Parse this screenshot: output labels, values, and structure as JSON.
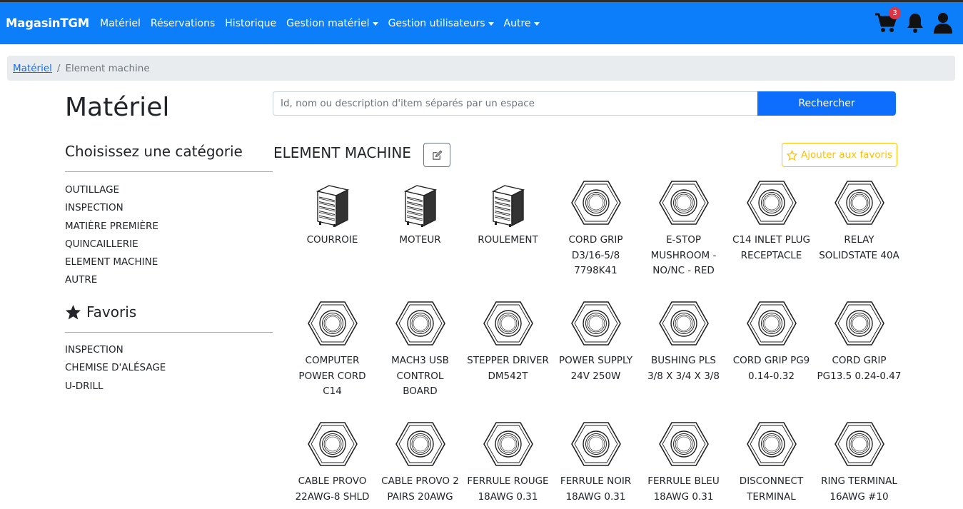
{
  "header": {
    "brand": "MagasinTGM",
    "nav": [
      {
        "label": "Matériel",
        "dropdown": false
      },
      {
        "label": "Réservations",
        "dropdown": false
      },
      {
        "label": "Historique",
        "dropdown": false
      },
      {
        "label": "Gestion matériel",
        "dropdown": true
      },
      {
        "label": "Gestion utilisateurs",
        "dropdown": true
      },
      {
        "label": "Autre",
        "dropdown": true
      }
    ],
    "cart_count": "3",
    "icons": [
      "cart-icon",
      "bell-icon",
      "user-icon"
    ],
    "bg_color": "#0d7efa"
  },
  "breadcrumb": {
    "link": "Matériel",
    "current": "Element machine"
  },
  "page": {
    "title": "Matériel"
  },
  "search": {
    "placeholder": "Id, nom ou description d'item séparés par un espace",
    "button": "Rechercher"
  },
  "sidebar": {
    "categories_title": "Choisissez une catégorie",
    "categories": [
      "OUTILLAGE",
      "INSPECTION",
      "MATIÈRE PREMIÈRE",
      "QUINCAILLERIE",
      "ELEMENT MACHINE",
      "AUTRE"
    ],
    "favorites_title": "Favoris",
    "favorites": [
      "INSPECTION",
      "CHEMISE D'ALÉSAGE",
      "U-DRILL"
    ]
  },
  "main": {
    "section_title": "ELEMENT MACHINE",
    "favorite_button": "Ajouter aux favoris",
    "items": [
      {
        "lines": [
          "COURROIE"
        ],
        "icon": "cabinet-icon"
      },
      {
        "lines": [
          "MOTEUR"
        ],
        "icon": "cabinet-icon"
      },
      {
        "lines": [
          "ROULEMENT"
        ],
        "icon": "cabinet-icon"
      },
      {
        "lines": [
          "CORD GRIP",
          "D3/16-5/8",
          "7798K41"
        ],
        "icon": "hex-nut-icon"
      },
      {
        "lines": [
          "E-STOP",
          "MUSHROOM -",
          "NO/NC - RED"
        ],
        "icon": "hex-nut-icon"
      },
      {
        "lines": [
          "C14 INLET PLUG",
          "RECEPTACLE"
        ],
        "icon": "hex-nut-icon"
      },
      {
        "lines": [
          "RELAY",
          "SOLIDSTATE 40A"
        ],
        "icon": "hex-nut-icon"
      },
      {
        "lines": [
          "COMPUTER",
          "POWER CORD",
          "C14"
        ],
        "icon": "hex-nut-icon"
      },
      {
        "lines": [
          "MACH3 USB",
          "CONTROL",
          "BOARD"
        ],
        "icon": "hex-nut-icon"
      },
      {
        "lines": [
          "STEPPER DRIVER",
          "DM542T"
        ],
        "icon": "hex-nut-icon"
      },
      {
        "lines": [
          "POWER SUPPLY",
          "24V 250W"
        ],
        "icon": "hex-nut-icon"
      },
      {
        "lines": [
          "BUSHING PLS",
          "3/8 X 3/4 X 3/8"
        ],
        "icon": "hex-nut-icon"
      },
      {
        "lines": [
          "CORD GRIP PG9",
          "0.14-0.32"
        ],
        "icon": "hex-nut-icon"
      },
      {
        "lines": [
          "CORD GRIP",
          "PG13.5 0.24-0.47"
        ],
        "icon": "hex-nut-icon"
      },
      {
        "lines": [
          "CABLE PROVO",
          "22AWG-8 SHLD"
        ],
        "icon": "hex-nut-icon"
      },
      {
        "lines": [
          "CABLE PROVO 2",
          "PAIRS 20AWG"
        ],
        "icon": "hex-nut-icon"
      },
      {
        "lines": [
          "FERRULE ROUGE",
          "18AWG 0.31"
        ],
        "icon": "hex-nut-icon"
      },
      {
        "lines": [
          "FERRULE NOIR",
          "18AWG 0.31"
        ],
        "icon": "hex-nut-icon"
      },
      {
        "lines": [
          "FERRULE BLEU",
          "18AWG 0.31"
        ],
        "icon": "hex-nut-icon"
      },
      {
        "lines": [
          "DISCONNECT",
          "TERMINAL"
        ],
        "icon": "hex-nut-icon"
      },
      {
        "lines": [
          "RING TERMINAL",
          "16AWG #10"
        ],
        "icon": "hex-nut-icon"
      }
    ]
  }
}
